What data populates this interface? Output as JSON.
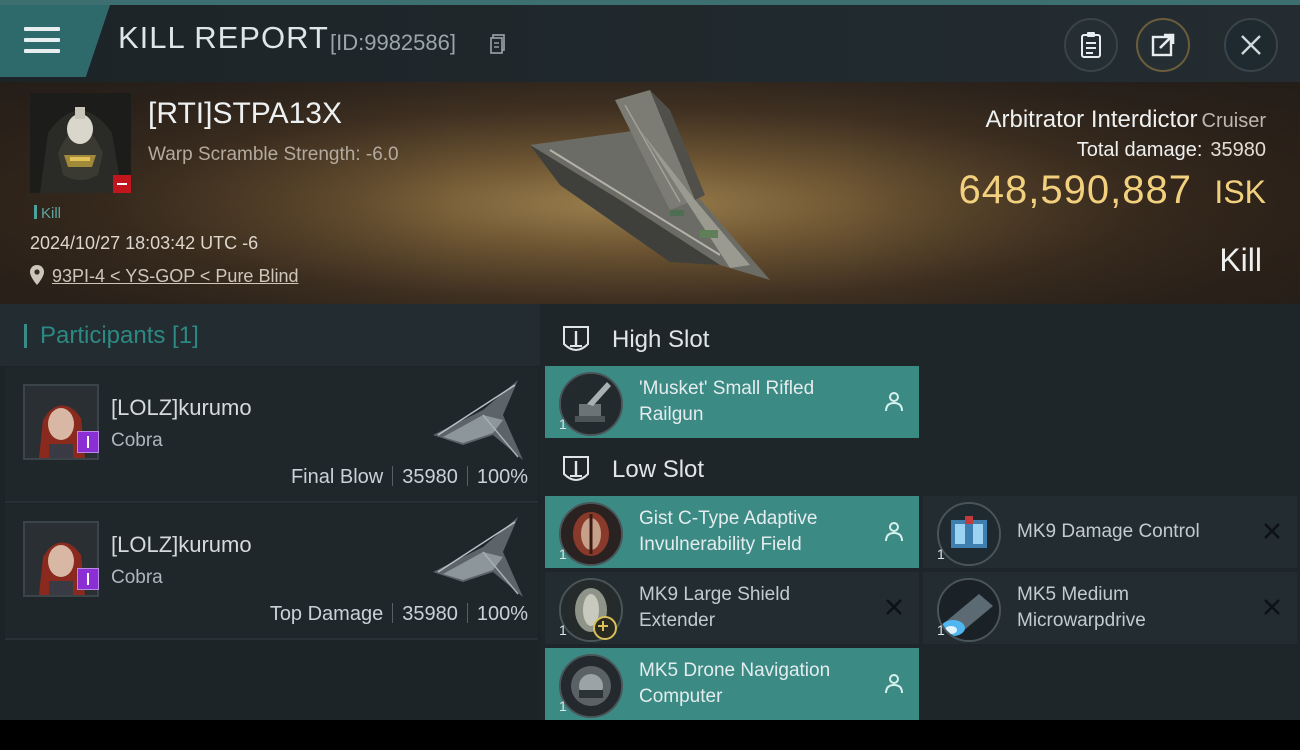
{
  "header": {
    "title": "KILL REPORT",
    "report_id": "[ID:9982586]"
  },
  "victim": {
    "name": "[RTI]STPA13X",
    "warp_scramble": "Warp Scramble Strength: -6.0",
    "kill_tag": "Kill",
    "datetime": "2024/10/27 18:03:42 UTC -6",
    "location": "93PI-4 < YS-GOP < Pure Blind"
  },
  "ship": {
    "name": "Arbitrator Interdictor",
    "class": "Cruiser",
    "total_damage_label": "Total damage:",
    "total_damage": "35980",
    "isk_value": "648,590,887",
    "isk_label": "ISK",
    "result": "Kill"
  },
  "participants": {
    "title": "Participants [1]",
    "rows": [
      {
        "name": "[LOLZ]kurumo",
        "ship": "Cobra",
        "role": "Final Blow",
        "damage": "35980",
        "percent": "100%"
      },
      {
        "name": "[LOLZ]kurumo",
        "ship": "Cobra",
        "role": "Top Damage",
        "damage": "35980",
        "percent": "100%"
      }
    ]
  },
  "slots": {
    "high": {
      "title": "High Slot",
      "modules": [
        {
          "qty": "1",
          "name": "'Musket' Small Rifled Railgun",
          "status": "fitted"
        }
      ]
    },
    "low": {
      "title": "Low Slot",
      "modules": [
        {
          "qty": "1",
          "name": "Gist C-Type Adaptive Invulnerability Field",
          "status": "fitted"
        },
        {
          "qty": "1",
          "name": "MK9 Damage Control",
          "status": "dropped"
        },
        {
          "qty": "1",
          "name": "MK9 Large Shield Extender",
          "status": "dropped"
        },
        {
          "qty": "1",
          "name": "MK5 Medium Microwarpdrive",
          "status": "dropped"
        },
        {
          "qty": "1",
          "name": "MK5 Drone Navigation Computer",
          "status": "fitted"
        }
      ]
    }
  },
  "colors": {
    "accent_teal": "#3b8a84",
    "isk_gold": "#f2d07e",
    "corp_red": "#c2151e",
    "badge_purple": "#8b2fd4"
  }
}
